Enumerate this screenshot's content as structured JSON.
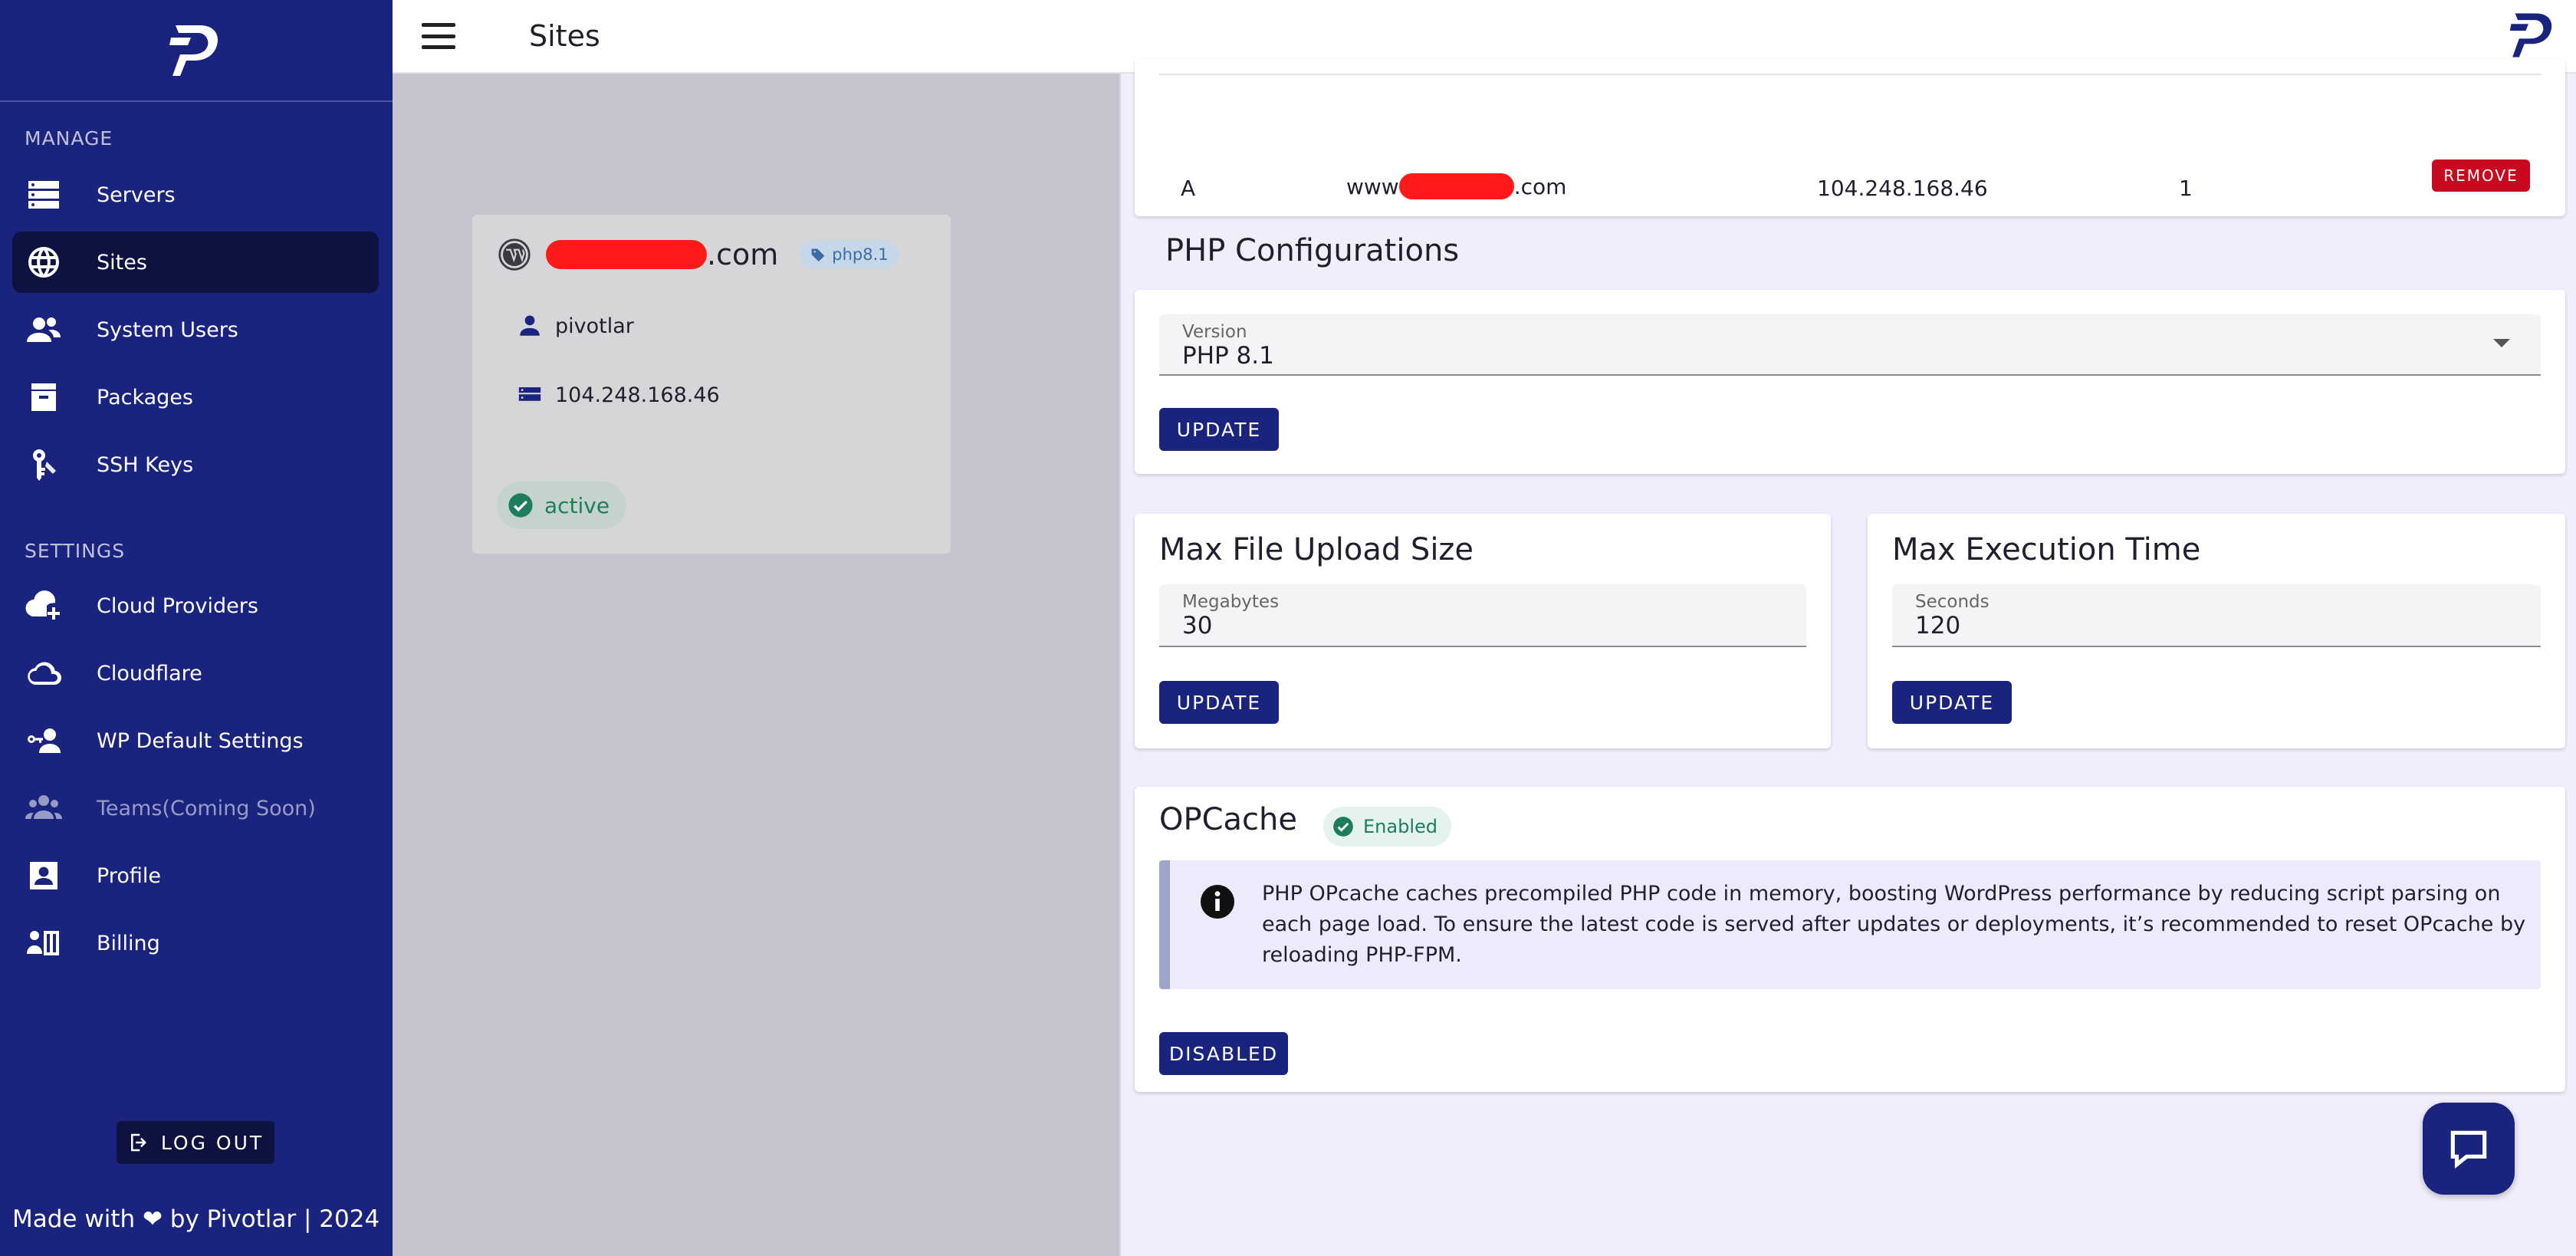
{
  "sidebar": {
    "logo_icon": "pivotlar-logo-icon",
    "manage_label": "MANAGE",
    "settings_label": "SETTINGS",
    "manage_items": [
      {
        "label": "Servers",
        "icon": "server-icon"
      },
      {
        "label": "Sites",
        "icon": "globe-icon",
        "active": true
      },
      {
        "label": "System Users",
        "icon": "users-icon"
      },
      {
        "label": "Packages",
        "icon": "package-icon"
      },
      {
        "label": "SSH Keys",
        "icon": "key-icon"
      }
    ],
    "settings_items": [
      {
        "label": "Cloud Providers",
        "icon": "cloud-add-icon"
      },
      {
        "label": "Cloudflare",
        "icon": "cloud-icon"
      },
      {
        "label": "WP Default Settings",
        "icon": "user-key-icon"
      },
      {
        "label": "Teams(Coming Soon)",
        "icon": "group-icon",
        "disabled": true
      },
      {
        "label": "Profile",
        "icon": "profile-icon"
      },
      {
        "label": "Billing",
        "icon": "billing-icon"
      }
    ],
    "logout_label": "LOG OUT",
    "footer": "Made with ❤ by Pivotlar | 2024"
  },
  "topbar": {
    "title": "Sites",
    "menu_icon": "hamburger-menu-icon",
    "brand_icon": "pivotlar-logo-icon"
  },
  "site_card": {
    "domain_suffix": ".com",
    "php_tag": "php8.1",
    "user": "pivotlar",
    "ip": "104.248.168.46",
    "status": "active"
  },
  "dns_record": {
    "type": "A",
    "name_prefix": "www",
    "name_suffix": ".com",
    "value": "104.248.168.46",
    "ttl": "1",
    "remove_label": "REMOVE"
  },
  "php_config": {
    "section_title": "PHP Configurations",
    "version_label": "Version",
    "version_value": "PHP 8.1",
    "update_label": "UPDATE"
  },
  "upload": {
    "title": "Max File Upload Size",
    "field_label": "Megabytes",
    "value": "30",
    "update_label": "UPDATE"
  },
  "execution": {
    "title": "Max Execution Time",
    "field_label": "Seconds",
    "value": "120",
    "update_label": "UPDATE"
  },
  "opcache": {
    "title": "OPCache",
    "status_chip": "Enabled",
    "info_text": "PHP OPcache caches precompiled PHP code in memory, boosting WordPress performance by reducing script parsing on each page load. To ensure the latest code is served after updates or deployments, it’s recommended to reset OPcache by reloading PHP-FPM.",
    "toggle_label": "DISABLED"
  },
  "colors": {
    "sidebar_bg": "#1a237e",
    "active_item_bg": "#0d1240",
    "primary_button": "#1a237e",
    "danger_button": "#c70a1f",
    "success": "#1e7d5a",
    "panel_bg": "#f0eefc"
  }
}
